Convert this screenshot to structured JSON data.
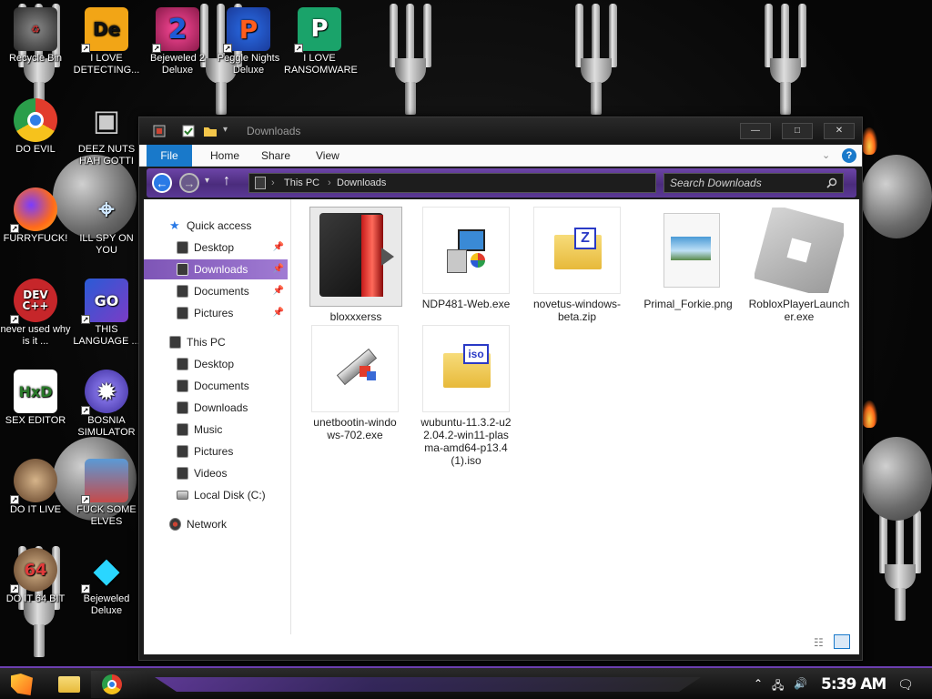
{
  "desktop": {
    "icons": [
      {
        "label": "Recycle Bin",
        "glyph": "♻"
      },
      {
        "label": "I LOVE DETECTING...",
        "glyph": "De"
      },
      {
        "label": "Bejeweled 2 Deluxe",
        "glyph": "2"
      },
      {
        "label": "Peggle Nights Deluxe",
        "glyph": "P"
      },
      {
        "label": "I LOVE RANSOMWARE",
        "glyph": "P"
      },
      {
        "label": "DO EVIL",
        "glyph": ""
      },
      {
        "label": "DEEZ NUTS HAH GOTTI",
        "glyph": "▣"
      },
      {
        "label": "FURRYFUCK!",
        "glyph": ""
      },
      {
        "label": "ILL SPY ON YOU",
        "glyph": "⌖"
      },
      {
        "label": "never used why is it ...",
        "glyph": "DEV C++"
      },
      {
        "label": "THIS LANGUAGE ...",
        "glyph": "GO"
      },
      {
        "label": "SEX EDITOR",
        "glyph": "HxD"
      },
      {
        "label": "BOSNIA SIMULATOR",
        "glyph": "✹"
      },
      {
        "label": "DO IT LIVE",
        "glyph": ""
      },
      {
        "label": "FUCK SOME ELVES",
        "glyph": ""
      },
      {
        "label": "DO IT 64 BIT",
        "glyph": "64"
      },
      {
        "label": "Bejeweled Deluxe",
        "glyph": "◆"
      }
    ]
  },
  "window": {
    "title": "Downloads",
    "ribbon_tabs": [
      "File",
      "Home",
      "Share",
      "View"
    ],
    "help": "?",
    "address": {
      "crumbs": [
        "This PC",
        "Downloads"
      ],
      "search_placeholder": "Search Downloads"
    },
    "nav": {
      "quick_access": "Quick access",
      "quick_items": [
        "Desktop",
        "Downloads",
        "Documents",
        "Pictures"
      ],
      "this_pc": "This PC",
      "pc_items": [
        "Desktop",
        "Documents",
        "Downloads",
        "Music",
        "Pictures",
        "Videos",
        "Local Disk (C:)"
      ],
      "network": "Network"
    },
    "files": [
      {
        "name": "bloxxxerss",
        "kind": "folder-dark"
      },
      {
        "name": "NDP481-Web.exe",
        "kind": "installer"
      },
      {
        "name": "novetus-windows-beta.zip",
        "kind": "zip"
      },
      {
        "name": "Primal_Forkie.png",
        "kind": "image"
      },
      {
        "name": "RobloxPlayerLauncher.exe",
        "kind": "roblox"
      },
      {
        "name": "unetbootin-windows-702.exe",
        "kind": "usb"
      },
      {
        "name": "wubuntu-11.3.2-u22.04.2-win11-plasma-amd64-p13.4(1).iso",
        "kind": "iso"
      }
    ]
  },
  "taskbar": {
    "time": "5:39 AM"
  },
  "colors": {
    "accent": "#7e55b6",
    "file_tab": "#1979ca",
    "taskbar_border": "#6c3fb0"
  }
}
